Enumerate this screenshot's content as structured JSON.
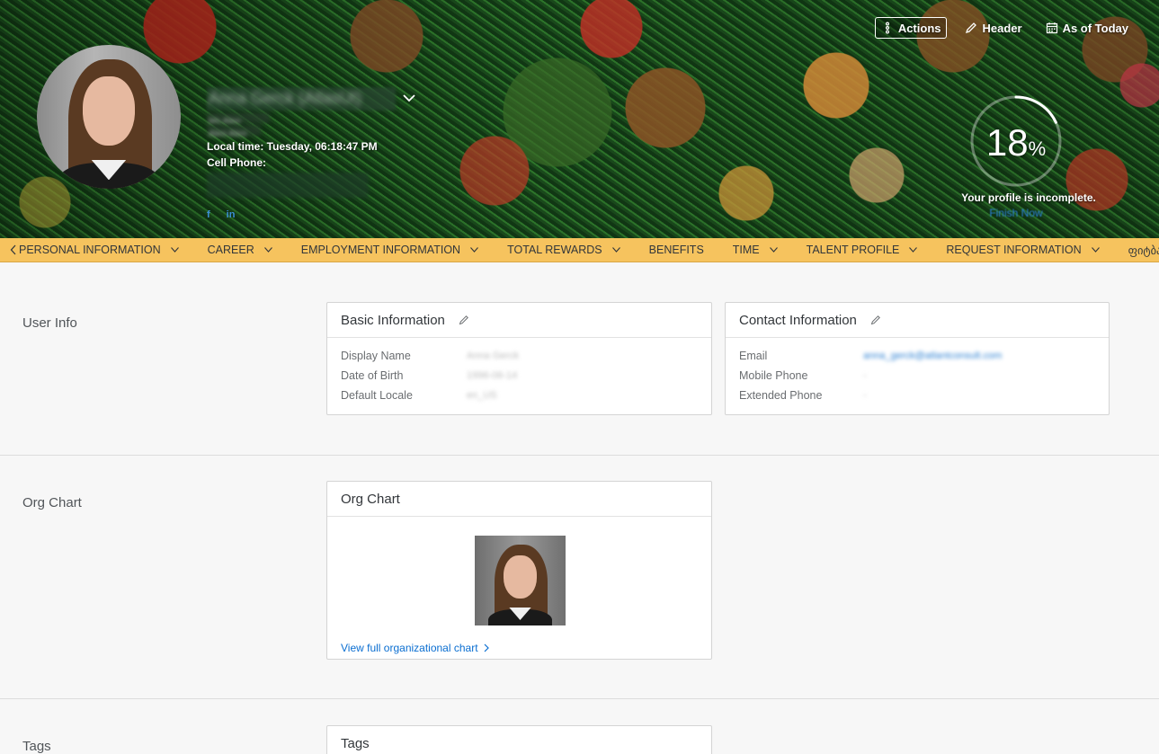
{
  "header": {
    "actions_label": "Actions",
    "header_label": "Header",
    "as_of_label": "As of Today",
    "employee_name": "Anna Gerck (AtlasUt)",
    "title_line1": "Ms Aleo",
    "title_line2": "Aleo Aleo",
    "local_time": "Local time: Tuesday, 06:18:47 PM",
    "cell_phone_label": "Cell Phone:",
    "social_facebook": "f",
    "social_linkedin": "in",
    "profile_completion_percent": 18,
    "profile_completion_number": "18",
    "profile_completion_unit": "%",
    "profile_note": "Your profile is incomplete.",
    "finish_now": "Finish Now"
  },
  "nav": {
    "items": [
      {
        "label": "PERSONAL INFORMATION",
        "has_menu": true
      },
      {
        "label": "CAREER",
        "has_menu": true
      },
      {
        "label": "EMPLOYMENT INFORMATION",
        "has_menu": true
      },
      {
        "label": "TOTAL REWARDS",
        "has_menu": true
      },
      {
        "label": "BENEFITS",
        "has_menu": false
      },
      {
        "label": "TIME",
        "has_menu": true
      },
      {
        "label": "TALENT PROFILE",
        "has_menu": true
      },
      {
        "label": "REQUEST INFORMATION",
        "has_menu": true
      },
      {
        "label": "ფიტბასი",
        "has_menu": true
      }
    ]
  },
  "sections": {
    "user_info": {
      "title": "User Info",
      "basic": {
        "title": "Basic Information",
        "fields": [
          {
            "label": "Display Name",
            "value": "Anna Gerck"
          },
          {
            "label": "Date of Birth",
            "value": "1996-06-14"
          },
          {
            "label": "Default Locale",
            "value": "en_US"
          }
        ]
      },
      "contact": {
        "title": "Contact Information",
        "fields": [
          {
            "label": "Email",
            "value": "anna_gerck@atlantconsult.com"
          },
          {
            "label": "Mobile Phone",
            "value": "-"
          },
          {
            "label": "Extended Phone",
            "value": "-"
          }
        ]
      }
    },
    "org_chart": {
      "title": "Org Chart",
      "card_title": "Org Chart",
      "link": "View full organizational chart"
    },
    "tags": {
      "title": "Tags",
      "card_title": "Tags"
    }
  },
  "colors": {
    "nav_bg": "#f6c35e",
    "link": "#0a6ed1",
    "page_bg": "#f7f7f7"
  }
}
